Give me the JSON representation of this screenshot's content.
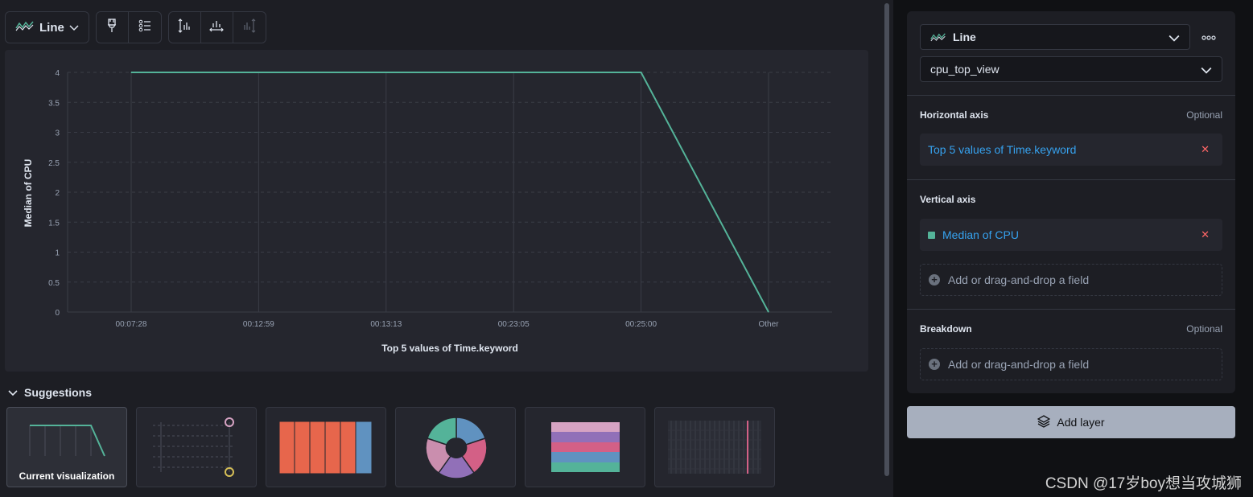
{
  "toolbar": {
    "chart_type": "Line"
  },
  "chart_data": {
    "type": "line",
    "categories": [
      "00:07:28",
      "00:12:59",
      "00:13:13",
      "00:23:05",
      "00:25:00",
      "Other"
    ],
    "series": [
      {
        "name": "Median of CPU",
        "values": [
          4,
          4,
          4,
          4,
          4,
          0
        ]
      }
    ],
    "xlabel": "Top 5 values of Time.keyword",
    "ylabel": "Median of CPU",
    "yticks": [
      "0",
      "0.5",
      "1",
      "1.5",
      "2",
      "2.5",
      "3",
      "3.5",
      "4"
    ],
    "ylim": [
      0,
      4
    ],
    "grid": true,
    "color": "#54b399"
  },
  "suggestions": {
    "title": "Suggestions",
    "current_label": "Current visualization"
  },
  "config": {
    "vis_type": "Line",
    "data_view": "cpu_top_view",
    "horizontal_axis": {
      "label": "Horizontal axis",
      "optional": "Optional",
      "field": "Top 5 values of Time.keyword"
    },
    "vertical_axis": {
      "label": "Vertical axis",
      "field": "Median of CPU",
      "add_field": "Add or drag-and-drop a field"
    },
    "breakdown": {
      "label": "Breakdown",
      "optional": "Optional",
      "add_field": "Add or drag-and-drop a field"
    },
    "add_layer": "Add layer"
  },
  "watermark": "CSDN @17岁boy想当攻城狮"
}
